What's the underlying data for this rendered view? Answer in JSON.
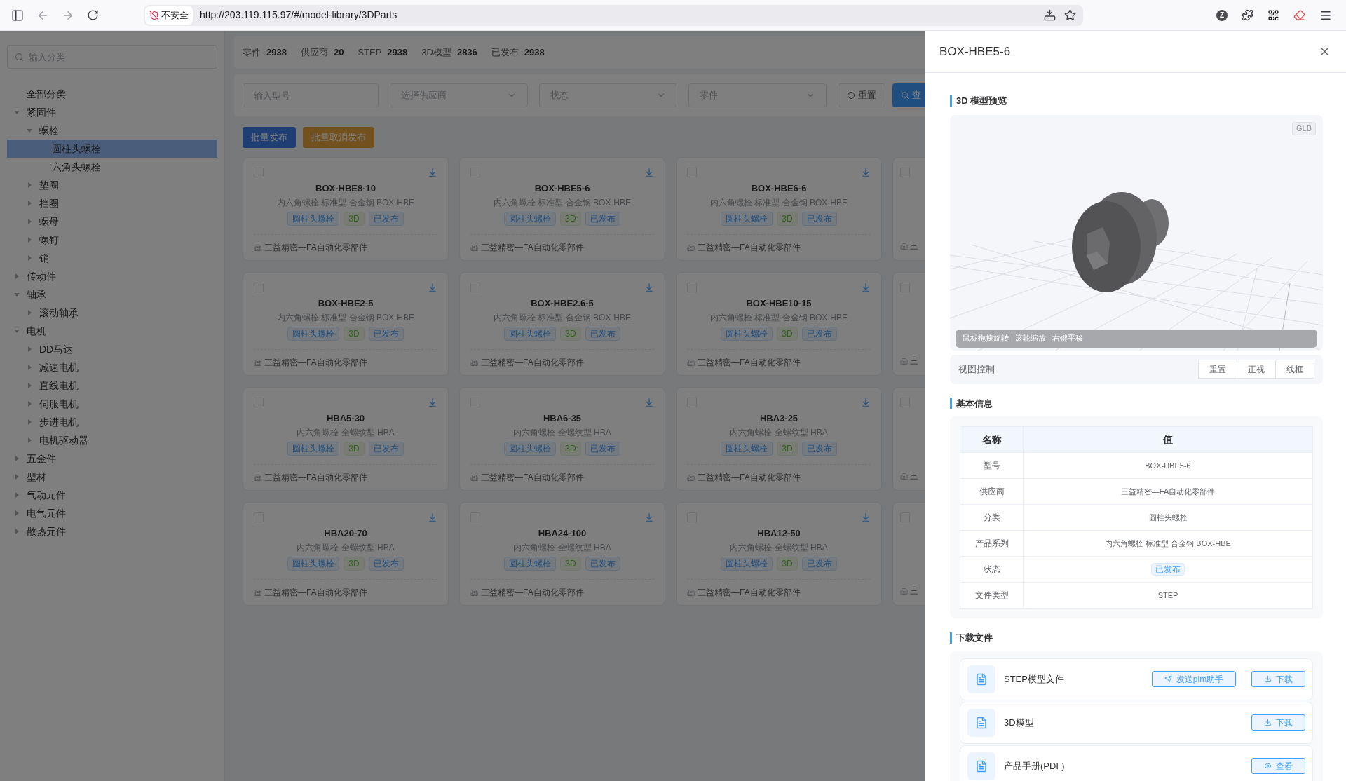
{
  "browser": {
    "security": "不安全",
    "url": "http://203.119.115.97/#/model-library/3DParts",
    "profile": "Z"
  },
  "sidebar": {
    "search": {
      "placeholder": "输入分类"
    },
    "tree": [
      {
        "label": "全部分类",
        "kind": "leaf",
        "selected": false
      },
      {
        "label": "紧固件",
        "kind": "group",
        "expanded": true,
        "selected": false,
        "children": [
          {
            "label": "螺栓",
            "kind": "group",
            "expanded": true,
            "selected": false,
            "children": [
              {
                "label": "圆柱头螺栓",
                "kind": "leaf",
                "selected": true
              },
              {
                "label": "六角头螺栓",
                "kind": "leaf",
                "selected": false
              }
            ]
          },
          {
            "label": "垫圈",
            "kind": "group",
            "expanded": false,
            "selected": false
          },
          {
            "label": "挡圈",
            "kind": "group",
            "expanded": false,
            "selected": false
          },
          {
            "label": "螺母",
            "kind": "group",
            "expanded": false,
            "selected": false
          },
          {
            "label": "螺钉",
            "kind": "group",
            "expanded": false,
            "selected": false
          },
          {
            "label": "销",
            "kind": "group",
            "expanded": false,
            "selected": false
          }
        ]
      },
      {
        "label": "传动件",
        "kind": "group",
        "expanded": false,
        "selected": false
      },
      {
        "label": "轴承",
        "kind": "group",
        "expanded": true,
        "selected": false,
        "children": [
          {
            "label": "滚动轴承",
            "kind": "group",
            "expanded": false,
            "selected": false
          }
        ]
      },
      {
        "label": "电机",
        "kind": "group",
        "expanded": true,
        "selected": false,
        "children": [
          {
            "label": "DD马达",
            "kind": "group",
            "expanded": false,
            "selected": false
          },
          {
            "label": "减速电机",
            "kind": "group",
            "expanded": false,
            "selected": false
          },
          {
            "label": "直线电机",
            "kind": "group",
            "expanded": false,
            "selected": false
          },
          {
            "label": "伺服电机",
            "kind": "group",
            "expanded": false,
            "selected": false
          },
          {
            "label": "步进电机",
            "kind": "group",
            "expanded": false,
            "selected": false
          },
          {
            "label": "电机驱动器",
            "kind": "group",
            "expanded": false,
            "selected": false
          }
        ]
      },
      {
        "label": "五金件",
        "kind": "group",
        "expanded": false,
        "selected": false
      },
      {
        "label": "型材",
        "kind": "group",
        "expanded": false,
        "selected": false
      },
      {
        "label": "气动元件",
        "kind": "group",
        "expanded": false,
        "selected": false
      },
      {
        "label": "电气元件",
        "kind": "group",
        "expanded": false,
        "selected": false
      },
      {
        "label": "散热元件",
        "kind": "group",
        "expanded": false,
        "selected": false
      }
    ]
  },
  "stats": [
    {
      "label": "零件",
      "value": "2938"
    },
    {
      "label": "供应商",
      "value": "20"
    },
    {
      "label": "STEP",
      "value": "2938"
    },
    {
      "label": "3D模型",
      "value": "2836"
    },
    {
      "label": "已发布",
      "value": "2938"
    }
  ],
  "filters": [
    {
      "kind": "input",
      "placeholder": "输入型号"
    },
    {
      "kind": "select",
      "placeholder": "选择供应商"
    },
    {
      "kind": "select",
      "placeholder": "状态"
    },
    {
      "kind": "select",
      "placeholder": "零件"
    }
  ],
  "filter_buttons": [
    {
      "kind": "reset",
      "label": "重置"
    },
    {
      "kind": "search",
      "label": "查"
    }
  ],
  "batch_buttons": [
    {
      "kind": "primary",
      "label": "批量发布"
    },
    {
      "kind": "warning",
      "label": "批量取消发布"
    }
  ],
  "cards": [
    {
      "kind": "full",
      "checked": false,
      "title": "BOX-HBE8-10",
      "desc": "内六角螺栓 标准型 合金钢 BOX-HBE",
      "tags": [
        {
          "kind": "category",
          "label": "圆柱头螺栓"
        },
        {
          "kind": "model",
          "label": "3D"
        },
        {
          "kind": "status",
          "label": "已发布"
        }
      ],
      "supplier": "三益精密—FA自动化零部件"
    },
    {
      "kind": "full",
      "checked": false,
      "title": "BOX-HBE5-6",
      "desc": "内六角螺栓 标准型 合金钢 BOX-HBE",
      "tags": [
        {
          "kind": "category",
          "label": "圆柱头螺栓"
        },
        {
          "kind": "model",
          "label": "3D"
        },
        {
          "kind": "status",
          "label": "已发布"
        }
      ],
      "supplier": "三益精密—FA自动化零部件"
    },
    {
      "kind": "full",
      "checked": false,
      "title": "BOX-HBE6-6",
      "desc": "内六角螺栓 标准型 合金钢 BOX-HBE",
      "tags": [
        {
          "kind": "category",
          "label": "圆柱头螺栓"
        },
        {
          "kind": "model",
          "label": "3D"
        },
        {
          "kind": "status",
          "label": "已发布"
        }
      ],
      "supplier": "三益精密—FA自动化零部件"
    },
    {
      "kind": "peek",
      "checked": false,
      "supplier": "三"
    },
    {
      "kind": "full",
      "checked": false,
      "title": "BOX-HBE2-5",
      "desc": "内六角螺栓 标准型 合金钢 BOX-HBE",
      "tags": [
        {
          "kind": "category",
          "label": "圆柱头螺栓"
        },
        {
          "kind": "model",
          "label": "3D"
        },
        {
          "kind": "status",
          "label": "已发布"
        }
      ],
      "supplier": "三益精密—FA自动化零部件"
    },
    {
      "kind": "full",
      "checked": false,
      "title": "BOX-HBE2.6-5",
      "desc": "内六角螺栓 标准型 合金钢 BOX-HBE",
      "tags": [
        {
          "kind": "category",
          "label": "圆柱头螺栓"
        },
        {
          "kind": "model",
          "label": "3D"
        },
        {
          "kind": "status",
          "label": "已发布"
        }
      ],
      "supplier": "三益精密—FA自动化零部件"
    },
    {
      "kind": "full",
      "checked": false,
      "title": "BOX-HBE10-15",
      "desc": "内六角螺栓 标准型 合金钢 BOX-HBE",
      "tags": [
        {
          "kind": "category",
          "label": "圆柱头螺栓"
        },
        {
          "kind": "model",
          "label": "3D"
        },
        {
          "kind": "status",
          "label": "已发布"
        }
      ],
      "supplier": "三益精密—FA自动化零部件"
    },
    {
      "kind": "peek",
      "checked": false,
      "supplier": "三"
    },
    {
      "kind": "full",
      "checked": false,
      "title": "HBA5-30",
      "desc": "内六角螺栓 全螺纹型 HBA",
      "tags": [
        {
          "kind": "category",
          "label": "圆柱头螺栓"
        },
        {
          "kind": "model",
          "label": "3D"
        },
        {
          "kind": "status",
          "label": "已发布"
        }
      ],
      "supplier": "三益精密—FA自动化零部件"
    },
    {
      "kind": "full",
      "checked": false,
      "title": "HBA6-35",
      "desc": "内六角螺栓 全螺纹型 HBA",
      "tags": [
        {
          "kind": "category",
          "label": "圆柱头螺栓"
        },
        {
          "kind": "model",
          "label": "3D"
        },
        {
          "kind": "status",
          "label": "已发布"
        }
      ],
      "supplier": "三益精密—FA自动化零部件"
    },
    {
      "kind": "full",
      "checked": false,
      "title": "HBA3-25",
      "desc": "内六角螺栓 全螺纹型 HBA",
      "tags": [
        {
          "kind": "category",
          "label": "圆柱头螺栓"
        },
        {
          "kind": "model",
          "label": "3D"
        },
        {
          "kind": "status",
          "label": "已发布"
        }
      ],
      "supplier": "三益精密—FA自动化零部件"
    },
    {
      "kind": "peek",
      "checked": false,
      "supplier": "三"
    },
    {
      "kind": "full",
      "checked": false,
      "title": "HBA20-70",
      "desc": "内六角螺栓 全螺纹型 HBA",
      "tags": [
        {
          "kind": "category",
          "label": "圆柱头螺栓"
        },
        {
          "kind": "model",
          "label": "3D"
        },
        {
          "kind": "status",
          "label": "已发布"
        }
      ],
      "supplier": "三益精密—FA自动化零部件"
    },
    {
      "kind": "full",
      "checked": false,
      "title": "HBA24-100",
      "desc": "内六角螺栓 全螺纹型 HBA",
      "tags": [
        {
          "kind": "category",
          "label": "圆柱头螺栓"
        },
        {
          "kind": "model",
          "label": "3D"
        },
        {
          "kind": "status",
          "label": "已发布"
        }
      ],
      "supplier": "三益精密—FA自动化零部件"
    },
    {
      "kind": "full",
      "checked": false,
      "title": "HBA12-50",
      "desc": "内六角螺栓 全螺纹型 HBA",
      "tags": [
        {
          "kind": "category",
          "label": "圆柱头螺栓"
        },
        {
          "kind": "model",
          "label": "3D"
        },
        {
          "kind": "status",
          "label": "已发布"
        }
      ],
      "supplier": "三益精密—FA自动化零部件"
    },
    {
      "kind": "peek",
      "checked": false,
      "supplier": "三"
    }
  ],
  "drawer": {
    "title": "BOX-HBE5-6",
    "preview": {
      "heading": "3D 模型预览",
      "badge": "GLB",
      "hint": "鼠标拖拽旋转 | 滚轮缩放 | 右键平移",
      "control_label": "视图控制",
      "controls": [
        "重置",
        "正视",
        "线框"
      ]
    },
    "info": {
      "heading": "基本信息",
      "columns": [
        "名称",
        "值"
      ],
      "rows": [
        {
          "kind": "text",
          "name": "型号",
          "value": "BOX-HBE5-6"
        },
        {
          "kind": "text",
          "name": "供应商",
          "value": "三益精密—FA自动化零部件"
        },
        {
          "kind": "text",
          "name": "分类",
          "value": "圆柱头螺栓"
        },
        {
          "kind": "text",
          "name": "产品系列",
          "value": "内六角螺栓 标准型 合金钢 BOX-HBE"
        },
        {
          "kind": "tag",
          "name": "状态",
          "value": "已发布"
        },
        {
          "kind": "text",
          "name": "文件类型",
          "value": "STEP"
        }
      ]
    },
    "files": {
      "heading": "下载文件",
      "items": [
        {
          "name": "STEP模型文件",
          "actions": [
            {
              "kind": "send",
              "label": "发送plm助手"
            },
            {
              "kind": "download",
              "label": "下载"
            }
          ]
        },
        {
          "name": "3D模型",
          "actions": [
            {
              "kind": "download",
              "label": "下载"
            }
          ]
        },
        {
          "name": "产品手册(PDF)",
          "actions": [
            {
              "kind": "view",
              "label": "查看"
            }
          ]
        }
      ]
    }
  }
}
